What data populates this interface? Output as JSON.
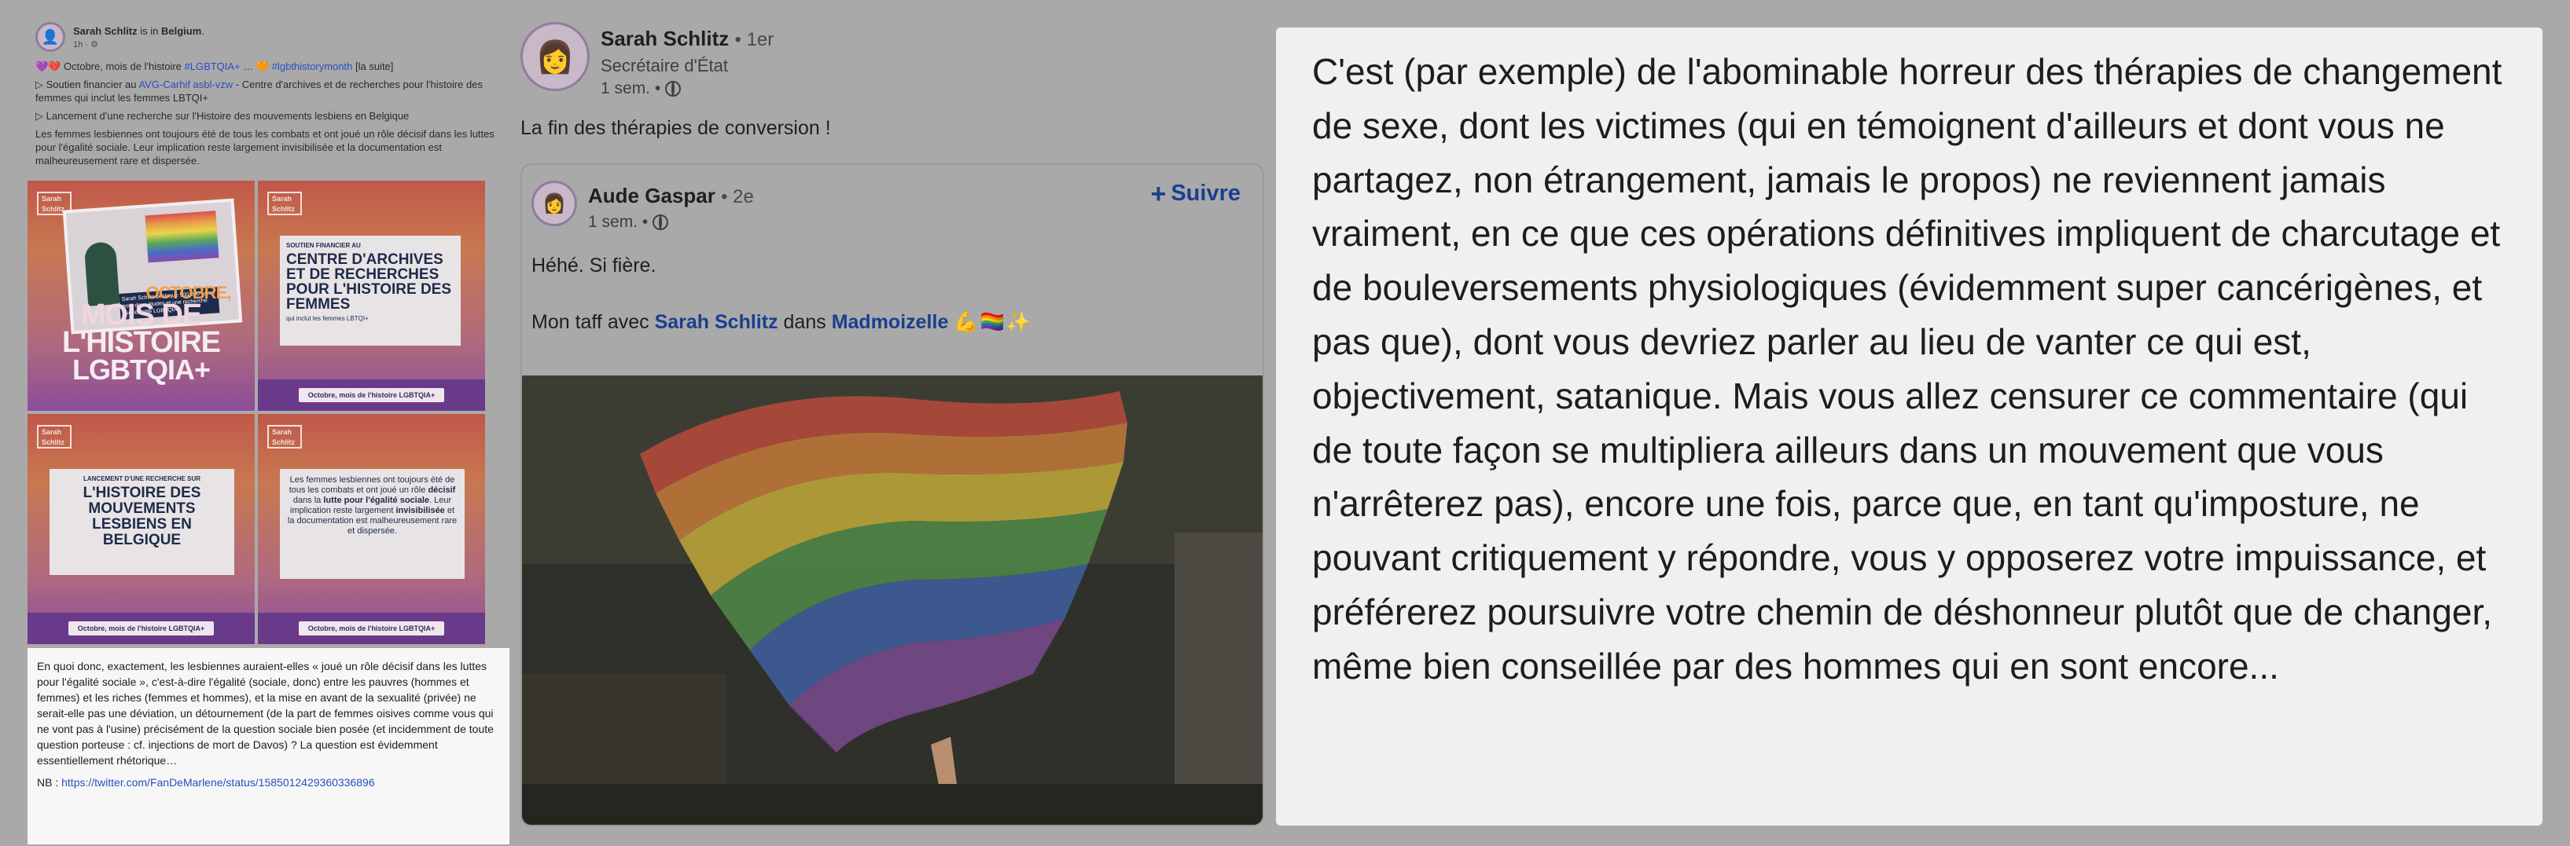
{
  "left_post": {
    "author": "Sarah Schlitz",
    "location_prefix": "is in",
    "location": "Belgium",
    "location_suffix": ".",
    "time": "1h ·",
    "line1_icons": "💜💔",
    "line1_text": "Octobre, mois de l'histoire",
    "line1_hashtag": "#LGBTQIA+",
    "line1_mid": "… 🧡",
    "line1_hashtag2": "#lgbthistorymonth",
    "line1_more": "[la suite]",
    "line2_prefix": "▷ Soutien financier au",
    "line2_link": "AVG-Carhif asbl-vzw",
    "line2_rest": "- Centre d'archives et de recherches pour l'histoire des femmes qui inclut les femmes LBTQI+",
    "line3": "▷ Lancement d'une recherche sur l'Histoire des mouvements lesbiens en Belgique",
    "line4": "Les femmes lesbiennes ont toujours été de tous les combats et ont joué un rôle décisif dans les luttes pour l'égalité sociale. Leur implication reste largement invisibilisée et la documentation est malheureusement rare et dispersée.",
    "tiles": {
      "logo_line1": "Sarah",
      "logo_line2": "Schlitz",
      "tile1_photo_caption": "Sarah Schlitz débloque 500.000 euros pour deux études et une recherche sur l'identité LGBTQIA+",
      "tile1_title1": "OCTOBRE,",
      "tile1_title2": "MOIS DE",
      "tile1_title3": "L'HISTOIRE",
      "tile1_title4": "LGBTQIA+",
      "tile2_kicker": "SOUTIEN FINANCIER AU",
      "tile2_title": "CENTRE D'ARCHIVES ET DE RECHERCHES POUR L'HISTOIRE DES FEMMES",
      "tile2_sub": "qui inclut les femmes LBTQI+",
      "tile3_kicker": "LANCEMENT D'UNE RECHERCHE SUR",
      "tile3_title": "L'HISTOIRE DES MOUVEMENTS LESBIENS EN BELGIQUE",
      "tile4_text_a": "Les femmes lesbiennes ont toujours été de tous les combats et ont joué un rôle",
      "tile4_bold1": "décisif",
      "tile4_text_b": "dans la",
      "tile4_bold2": "lutte pour l'égalité sociale",
      "tile4_text_c": ". Leur implication reste largement",
      "tile4_bold3": "invisibilisée",
      "tile4_text_d": "et la documentation est malheureusement rare et dispersée.",
      "footer": "Octobre, mois de l'histoire LGBTQIA+"
    },
    "comment": "En quoi donc, exactement, les lesbiennes auraient-elles « joué un rôle décisif dans les luttes pour l'égalité sociale », c'est-à-dire l'égalité (sociale, donc) entre les pauvres (hommes et femmes) et les riches (femmes et hommes), et la mise en avant de la sexualité (privée) ne serait-elle pas une déviation, un détournement (de la part de femmes oisives comme vous qui ne vont pas à l'usine) précisément de la question sociale bien posée (et incidemment de toute question porteuse : cf. injections de mort de Davos) ? La question est évidemment essentiellement rhétorique…",
    "nb_label": "NB :",
    "nb_link": "https://twitter.com/FanDeMarlene/status/1585012429360336896"
  },
  "mid_post": {
    "author": "Sarah Schlitz",
    "degree": "• 1er",
    "role": "Secrétaire d'État",
    "time": "1 sem. •",
    "caption": "La fin des thérapies de conversion !",
    "shared": {
      "author": "Aude Gaspar",
      "degree": "• 2e",
      "time": "1 sem. •",
      "follow_plus": "+",
      "follow_label": "Suivre",
      "line1": "Héhé. Si fière.",
      "line2_prefix": "Mon taff avec",
      "mention1": "Sarah Schlitz",
      "line2_mid": "dans",
      "mention2": "Madmoizelle",
      "emojis": "💪🏳️‍🌈✨"
    }
  },
  "right_panel": {
    "text": "C'est (par exemple) de l'abominable horreur des thérapies de changement de sexe, dont les victimes (qui en témoignent d'ailleurs et dont vous ne partagez, non étrangement, jamais le propos) ne reviennent jamais vraiment, en ce que ces opérations définitives impliquent de charcutage et de bouleversements physiologiques (évidemment super cancérigènes, et pas que), dont vous devriez parler au lieu de vanter ce qui est, objectivement, satanique. Mais vous allez censurer ce commentaire (qui de toute façon se multipliera ailleurs dans un mouvement que vous n'arrêterez pas), encore une fois, parce que, en tant qu'imposture, ne pouvant critiquement y répondre, vous y opposerez votre impuissance, et préférerez poursuivre votre chemin de déshonneur plutôt que de changer, même bien conseillée par des hommes qui en sont encore..."
  },
  "colors": {
    "page_bg": "#a9a9a9",
    "link_blue": "#1b3e8f",
    "panel_bg": "#f0f0f0"
  }
}
